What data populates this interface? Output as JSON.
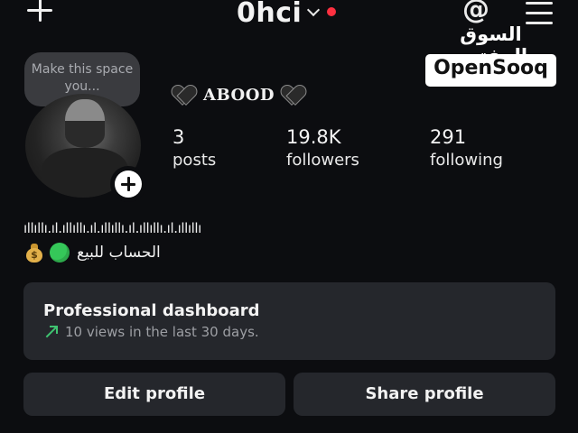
{
  "header": {
    "username": "0hci",
    "icons": [
      "plus-icon",
      "chevron-down-icon",
      "notification-dot",
      "threads-icon",
      "menu-icon"
    ],
    "notification_color": "#ff3040"
  },
  "watermark": {
    "arabic": "السوق المفتوح",
    "latin": "OpenSooq"
  },
  "profile": {
    "note_placeholder": "Make this space you...",
    "display_name": "ABOOD",
    "display_name_decoration": "black-heart-icon",
    "stats": [
      {
        "value": "3",
        "label": "posts"
      },
      {
        "value": "19.8K",
        "label": "followers"
      },
      {
        "value": "291",
        "label": "following"
      }
    ]
  },
  "bio": {
    "line1": "ıllıllı.ıl.ıllıllı.ıl.ıllıllı.ıl.ıllıllı.ıl.ıllıllı",
    "line2": "الحساب للبيع",
    "emojis": [
      "money-bag-icon",
      "green-circle-icon"
    ]
  },
  "dashboard": {
    "title": "Professional dashboard",
    "subtitle": "10 views in the last 30 days.",
    "accent": "#3fc471"
  },
  "actions": {
    "edit_label": "Edit profile",
    "share_label": "Share profile"
  },
  "theme": {
    "background": "#0c0d10",
    "card": "#25272c"
  }
}
